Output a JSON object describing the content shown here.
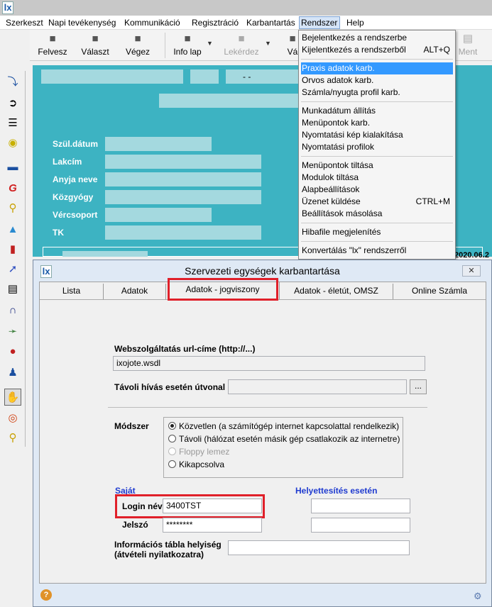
{
  "menubar": {
    "items": [
      "Szerkeszt",
      "Napi tevékenység",
      "Kommunikáció",
      "Regisztráció",
      "Karbantartás",
      "Rendszer",
      "Help"
    ],
    "active": "Rendszer"
  },
  "toolbar": {
    "buttons": [
      {
        "label": "Felvesz",
        "icon": "user-add-icon"
      },
      {
        "label": "Választ",
        "icon": "user-select-icon"
      },
      {
        "label": "Végez",
        "icon": "user-done-icon"
      },
      {
        "label": "Info lap",
        "icon": "info-user-icon"
      },
      {
        "label": "Lekérdez",
        "icon": "query-user-icon"
      },
      {
        "label": "Vá",
        "icon": "user-icon"
      },
      {
        "label": "Ment",
        "icon": "save-icon"
      }
    ]
  },
  "left_toolbar": {
    "icons": [
      "stethoscope-icon",
      "login-arrow-icon",
      "list-icon",
      "database-icon",
      "bed-icon",
      "g-letter-icon",
      "key-icon",
      "flask-icon",
      "test-tube-icon",
      "syringe-icon",
      "clipboard-icon",
      "magnet-icon",
      "injection-icon",
      "pills-icon",
      "person-icon",
      "hand-icon",
      "target-icon",
      "key-icon"
    ]
  },
  "background_form": {
    "header_dash": "- -",
    "labels": [
      "Szül.dátum",
      "Lakcím",
      "Anyja neve",
      "Közgyógy",
      "Vércsoport",
      "TK"
    ],
    "date_fragment": "2020.06.2"
  },
  "dropdown": {
    "items": [
      {
        "label": "Bejelentkezés a rendszerbe",
        "shortcut": ""
      },
      {
        "label": "Kijelentkezés a rendszerből",
        "shortcut": "ALT+Q"
      },
      {
        "label": "Praxis adatok karb.",
        "shortcut": "",
        "highlighted": true
      },
      {
        "label": "Orvos adatok karb.",
        "shortcut": ""
      },
      {
        "label": "Számla/nyugta profil karb.",
        "shortcut": ""
      },
      {
        "label": "Munkadátum állítás",
        "shortcut": ""
      },
      {
        "label": "Menüpontok karb.",
        "shortcut": ""
      },
      {
        "label": "Nyomtatási kép kialakítása",
        "shortcut": ""
      },
      {
        "label": "Nyomtatási profilok",
        "shortcut": ""
      },
      {
        "label": "Menüpontok tiltása",
        "shortcut": ""
      },
      {
        "label": "Modulok tiltása",
        "shortcut": ""
      },
      {
        "label": "Alapbeállítások",
        "shortcut": ""
      },
      {
        "label": "Üzenet küldése",
        "shortcut": "CTRL+M"
      },
      {
        "label": "Beállítások másolása",
        "shortcut": ""
      },
      {
        "label": "Hibafile megjelenítés",
        "shortcut": ""
      },
      {
        "label": "Konvertálás \"lx\" rendszerről",
        "shortcut": ""
      }
    ]
  },
  "dialog": {
    "title": "Szervezeti egységek karbantartása",
    "close_label": "✕",
    "tabs": [
      "Lista",
      "Adatok",
      "Adatok - jogviszony",
      "Adatok - életút, OMSZ",
      "Online Számla"
    ],
    "active_tab": "Adatok - jogviszony",
    "webservice": {
      "label": "Webszolgáltatás url-címe (http://...)",
      "value": "ixojote.wsdl"
    },
    "remote_path": {
      "label": "Távoli hívás esetén útvonal",
      "value": "",
      "browse_label": "..."
    },
    "method": {
      "label": "Módszer",
      "options": [
        {
          "label": "Közvetlen (a számítógép internet kapcsolattal rendelkezik)",
          "selected": true,
          "disabled": false
        },
        {
          "label": "Távoli (hálózat esetén másik gép csatlakozik az internetre)",
          "selected": false,
          "disabled": false
        },
        {
          "label": "Floppy lemez",
          "selected": false,
          "disabled": true
        },
        {
          "label": "Kikapcsolva",
          "selected": false,
          "disabled": false
        }
      ]
    },
    "own_heading": "Saját",
    "substitute_heading": "Helyettesítés esetén",
    "login": {
      "label": "Login név",
      "value": "3400TST",
      "sub_value": ""
    },
    "password": {
      "label": "Jelszó",
      "value": "********",
      "sub_value": ""
    },
    "info_table": {
      "label_line1": "Információs tábla helyiség",
      "label_line2": "(átvételi nyilatkozatra)",
      "value": ""
    },
    "help_icon": "?",
    "colors": {
      "highlight_red": "#e0202a",
      "menu_highlight": "#3399ff",
      "background_teal": "#3db3c2",
      "blue_label": "#1f3bd0"
    }
  }
}
